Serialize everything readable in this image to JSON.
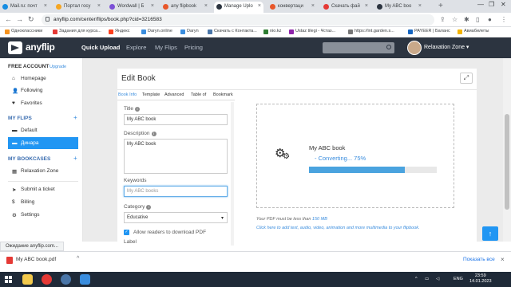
{
  "browser": {
    "tabs": [
      {
        "label": "Mail.ru: почт",
        "color": "#168de2"
      },
      {
        "label": "Портал госу",
        "color": "#f5a623"
      },
      {
        "label": "Wordwall | Б",
        "color": "#7b4fd6"
      },
      {
        "label": "any flipbook",
        "color": "#e8572a"
      },
      {
        "label": "Manage Uplo",
        "color": "#2c3440"
      },
      {
        "label": "конвертаци",
        "color": "#e8572a"
      },
      {
        "label": "Скачать фай",
        "color": "#e53935"
      },
      {
        "label": "My ABC boo",
        "color": "#2c3440"
      }
    ],
    "new_tab": "+",
    "close_glyph": "×",
    "url": "anyflip.com/center/flips/book.php?cid=3216583",
    "bookmarks": [
      {
        "label": "Одноклассники",
        "color": "#f7931e"
      },
      {
        "label": "Задания для курса...",
        "color": "#e53935"
      },
      {
        "label": "Яндекс",
        "color": "#fc3f1d"
      },
      {
        "label": "Daryn.online",
        "color": "#3a8dde"
      },
      {
        "label": "Daryn",
        "color": "#3a8dde"
      },
      {
        "label": "Скачать с Контакта...",
        "color": "#4a76a8"
      },
      {
        "label": "nio.kz",
        "color": "#2e7d32"
      },
      {
        "label": "Ustaz tilegi - Ұстаз...",
        "color": "#8e24aa"
      },
      {
        "label": "https://int.garden.s...",
        "color": "#777777"
      },
      {
        "label": "PAYEER | Баланс",
        "color": "#1565c0"
      },
      {
        "label": "Авиабилеты",
        "color": "#f4b400"
      }
    ]
  },
  "site": {
    "logo": "anyflip",
    "nav": [
      "Quick Upload",
      "Explore",
      "My Flips",
      "Pricing"
    ],
    "user_name": "Relaxation Zone ▾"
  },
  "sidebar": {
    "account_title": "FREE ACCOUNT",
    "upgrade": "Upgrade",
    "account_items": [
      {
        "label": "Homepage",
        "icon": "⌂"
      },
      {
        "label": "Following",
        "icon": "👤"
      },
      {
        "label": "Favorites",
        "icon": "♥"
      }
    ],
    "flips_title": "MY FLIPS",
    "flips_items": [
      {
        "label": "Default",
        "icon": "▬"
      },
      {
        "label": "Динара",
        "icon": "▬"
      }
    ],
    "bookcases_title": "MY BOOKCASES",
    "bookcases_items": [
      {
        "label": "Relaxation Zone",
        "icon": "▦"
      }
    ],
    "bottom_items": [
      {
        "label": "Submit a ticket",
        "icon": "➤"
      },
      {
        "label": "Billing",
        "icon": "$"
      },
      {
        "label": "Settings",
        "icon": "⚙"
      }
    ],
    "plus": "+"
  },
  "edit_book": {
    "title": "Edit Book",
    "tabs": [
      "Book Info",
      "Template",
      "Advanced",
      "Table of",
      "Bookmark"
    ],
    "title_label": "Title",
    "title_value": "My ABC book",
    "description_label": "Description",
    "description_value": "My ABC book",
    "keywords_label": "Keywords",
    "keywords_placeholder": "My ABC books",
    "category_label": "Category",
    "category_value": "Educative",
    "allow_download_label": "Allow readers to download PDF",
    "label_cut": "Label"
  },
  "converting": {
    "book_name": "My ABC book",
    "status": "- Converting... 75%",
    "progress": 0.75,
    "note_prefix": "Your PDF must be less than",
    "note_size": "150 MB",
    "note_link": "Click here to add text, audio, video, animation and more multimedia to your flipbook."
  },
  "status_bar": "Ожидание anyflip.com...",
  "downloads": {
    "file": "My ABC book.pdf",
    "show_all": "Показать все"
  },
  "taskbar": {
    "lang": "ENG",
    "time": "23:59",
    "date": "14.01.2023"
  }
}
